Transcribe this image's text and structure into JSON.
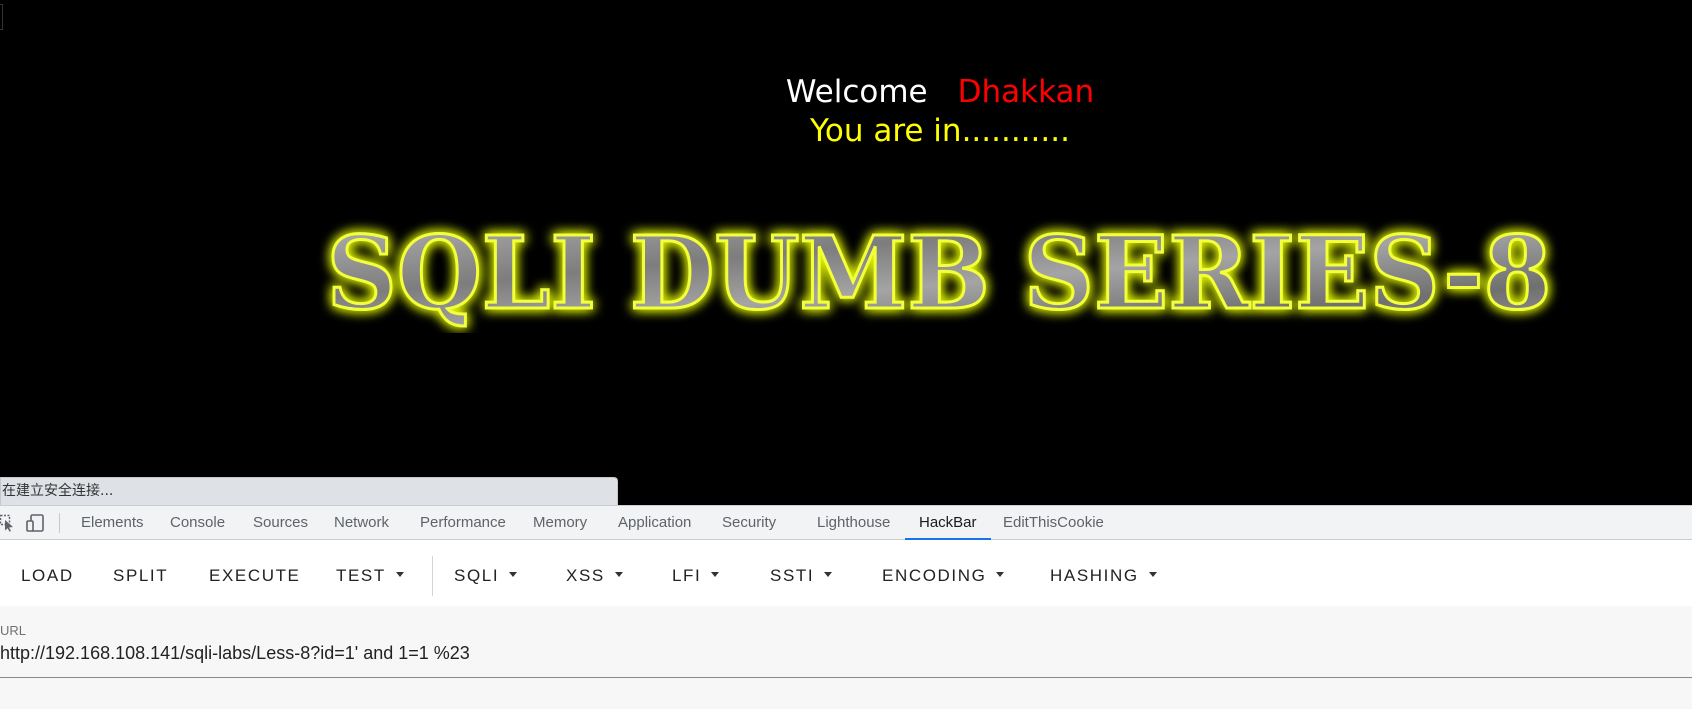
{
  "page": {
    "welcome_word": "Welcome",
    "user_name": "Dhakkan",
    "status_text": "You are in...........",
    "banner_title": "SQLI DUMB SERIES-8",
    "colors": {
      "background": "#000000",
      "welcome": "#ffffff",
      "name": "#ff0000",
      "status": "#ffff00",
      "banner_glow": "#e8ff00"
    }
  },
  "status_bubble": {
    "text": "在建立安全连接..."
  },
  "devtools": {
    "tabs": [
      {
        "label": "Elements"
      },
      {
        "label": "Console"
      },
      {
        "label": "Sources"
      },
      {
        "label": "Network"
      },
      {
        "label": "Performance"
      },
      {
        "label": "Memory"
      },
      {
        "label": "Application"
      },
      {
        "label": "Security"
      },
      {
        "label": "Lighthouse"
      },
      {
        "label": "HackBar",
        "active": true
      },
      {
        "label": "EditThisCookie"
      }
    ],
    "icons": [
      "inspect-element-icon",
      "device-toolbar-icon"
    ],
    "active_color": "#1a73e8"
  },
  "hackbar": {
    "buttons": [
      {
        "label": "LOAD",
        "dropdown": false
      },
      {
        "label": "SPLIT",
        "dropdown": false
      },
      {
        "label": "EXECUTE",
        "dropdown": false
      },
      {
        "label": "TEST",
        "dropdown": true
      },
      {
        "label": "SQLI",
        "dropdown": true
      },
      {
        "label": "XSS",
        "dropdown": true
      },
      {
        "label": "LFI",
        "dropdown": true
      },
      {
        "label": "SSTI",
        "dropdown": true
      },
      {
        "label": "ENCODING",
        "dropdown": true
      },
      {
        "label": "HASHING",
        "dropdown": true
      }
    ],
    "url_label": "URL",
    "url_value": "http://192.168.108.141/sqli-labs/Less-8?id=1' and 1=1 %23"
  }
}
